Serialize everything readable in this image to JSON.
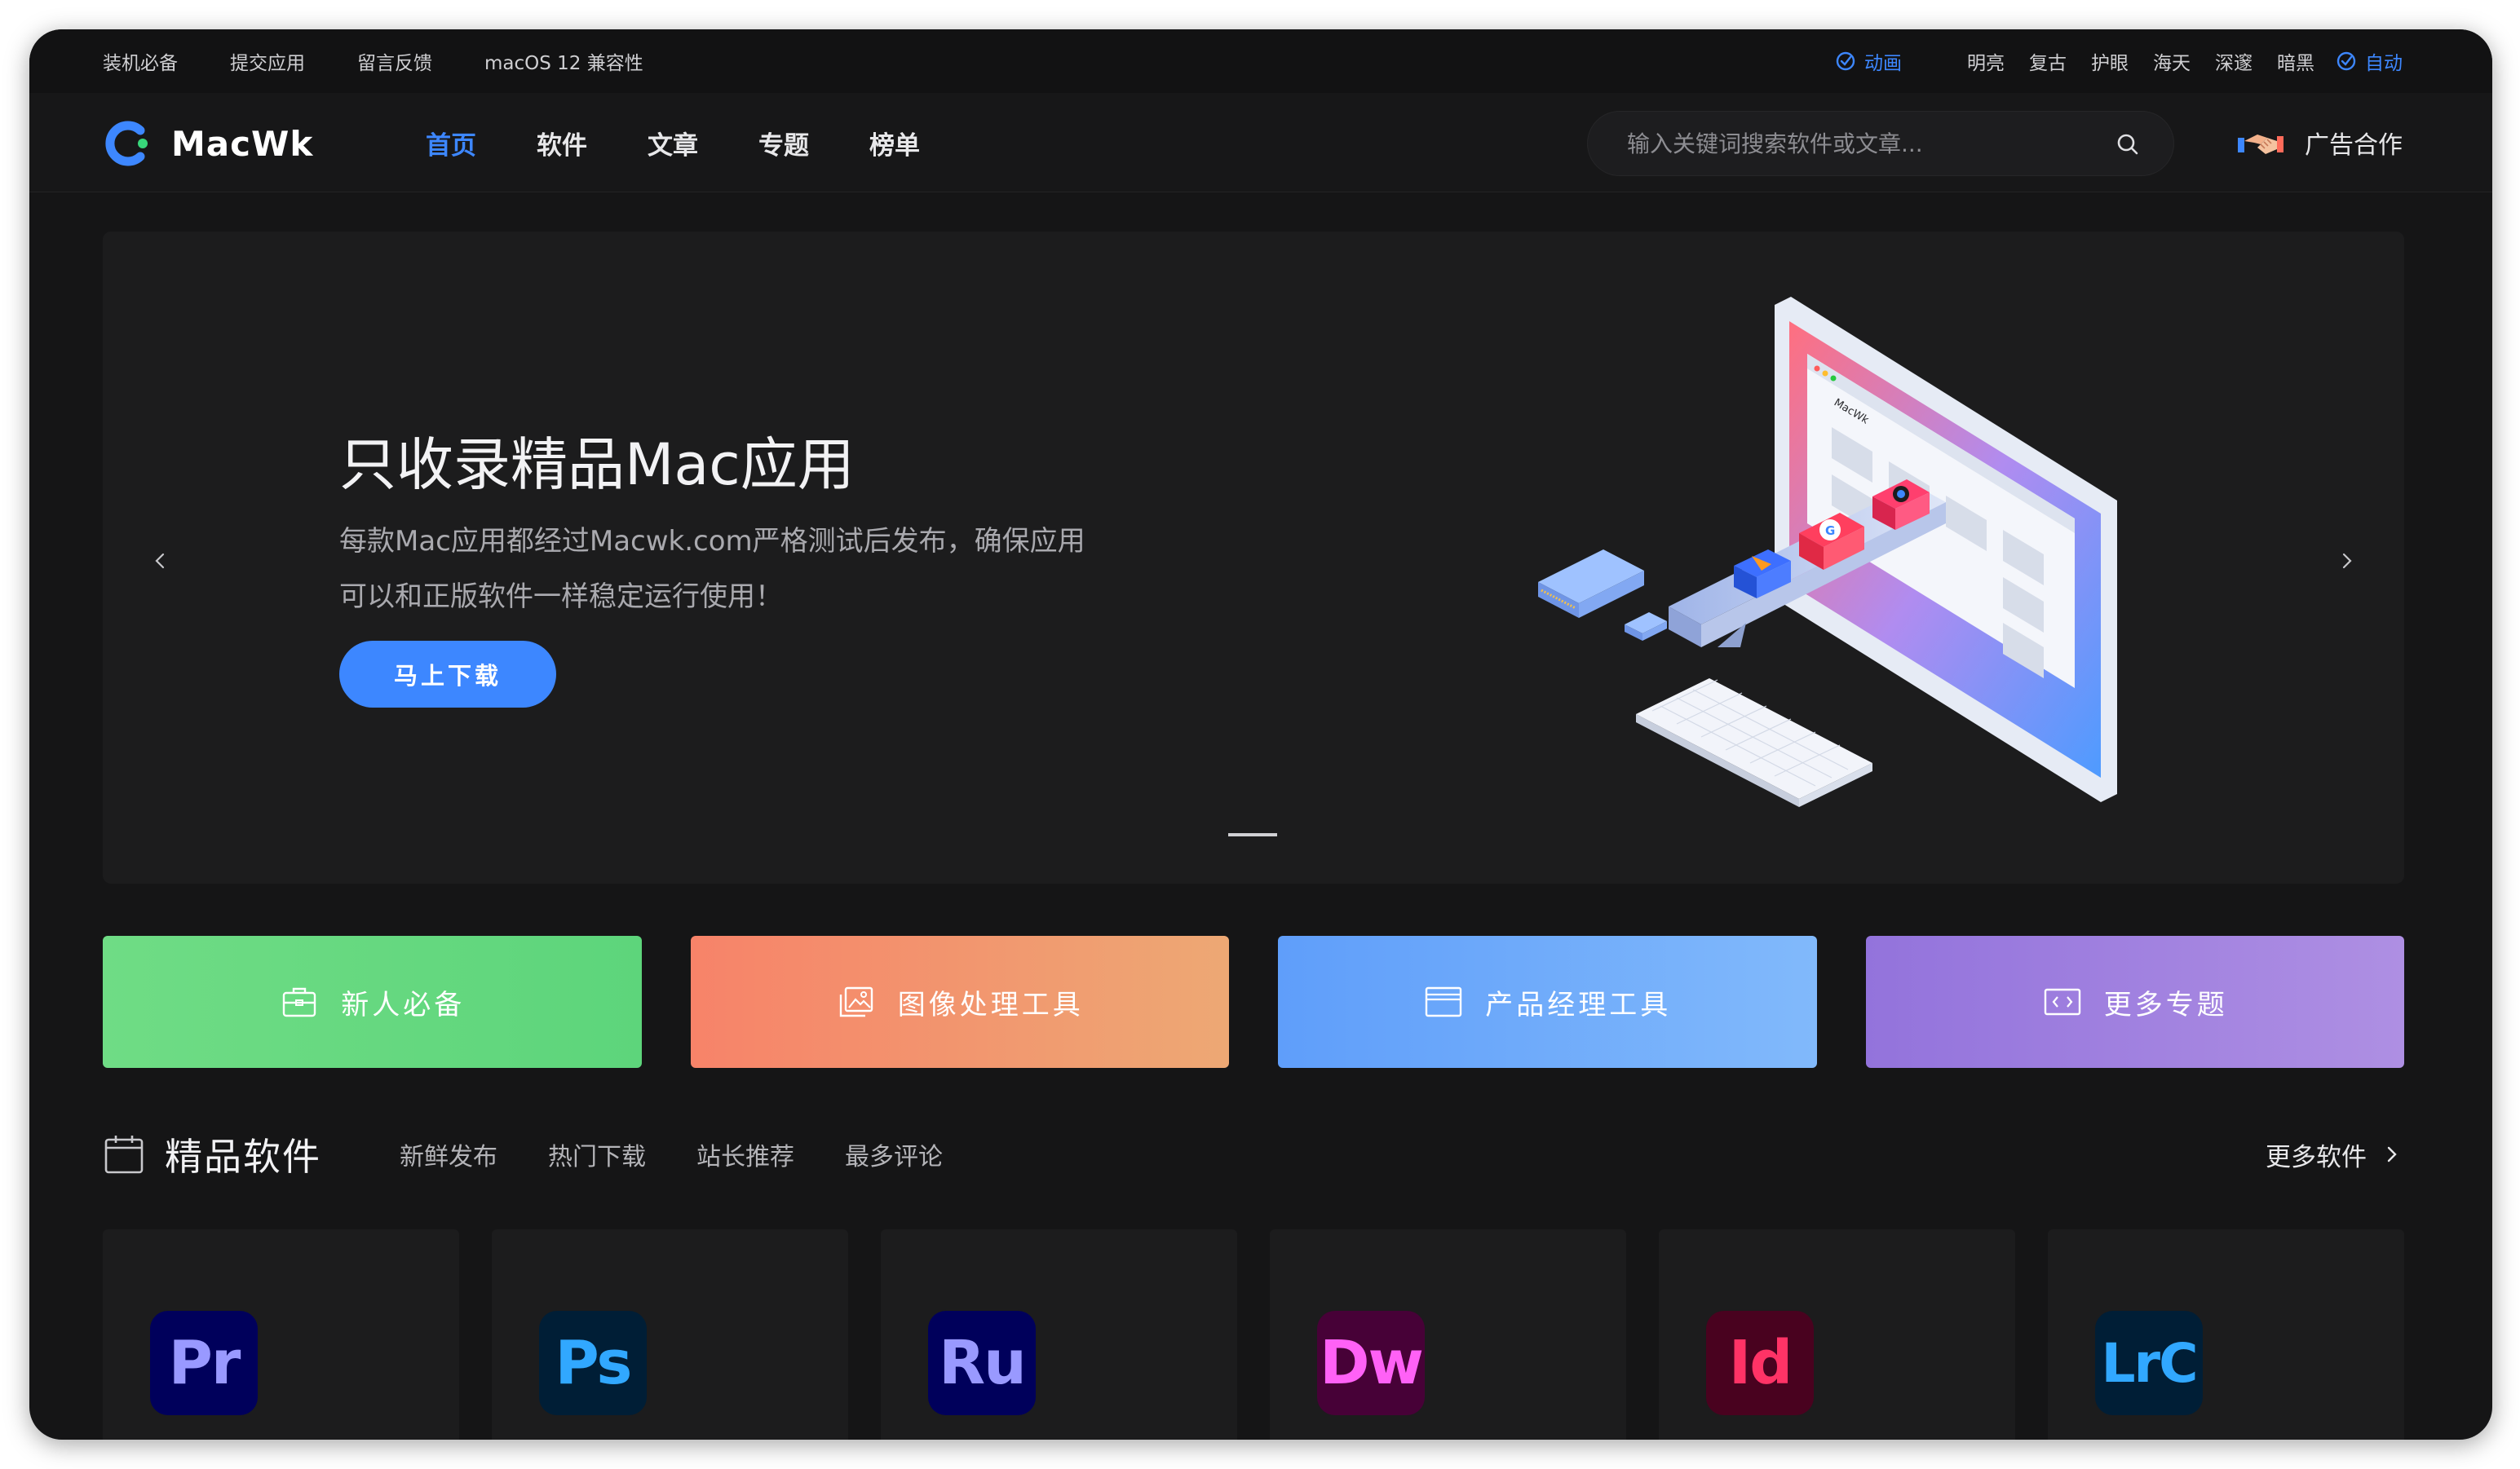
{
  "topbar": {
    "links": [
      "装机必备",
      "提交应用",
      "留言反馈",
      "macOS 12 兼容性"
    ],
    "animation_label": "动画",
    "themes": [
      "明亮",
      "复古",
      "护眼",
      "海天",
      "深邃",
      "暗黑"
    ],
    "auto_label": "自动"
  },
  "nav": {
    "logo_text": "MacWk",
    "menu": [
      "首页",
      "软件",
      "文章",
      "专题",
      "榜单"
    ],
    "active_menu": "首页",
    "search_placeholder": "输入关键词搜索软件或文章...",
    "ad_label": "广告合作"
  },
  "hero": {
    "title": "只收录精品Mac应用",
    "subtitle": "每款Mac应用都经过Macwk.com严格测试后发布，确保应用可以和正版软件一样稳定运行使用！",
    "button_label": "马上下载",
    "screen_brand": "MacWk"
  },
  "tiles": [
    "新人必备",
    "图像处理工具",
    "产品经理工具",
    "更多专题"
  ],
  "section": {
    "title": "精品软件",
    "tabs": [
      "新鲜发布",
      "热门下载",
      "站长推荐",
      "最多评论"
    ],
    "more_label": "更多软件"
  },
  "apps": [
    {
      "abbr": "Pr",
      "icon": "premiere-icon",
      "bg": "#00005b",
      "fg": "#9999ff"
    },
    {
      "abbr": "Ps",
      "icon": "photoshop-icon",
      "bg": "#001e36",
      "fg": "#31a8ff"
    },
    {
      "abbr": "Ru",
      "icon": "rush-icon",
      "bg": "#00005b",
      "fg": "#9999ff"
    },
    {
      "abbr": "Dw",
      "icon": "dreamweaver-icon",
      "bg": "#470137",
      "fg": "#ff61f6"
    },
    {
      "abbr": "Id",
      "icon": "indesign-icon",
      "bg": "#49021f",
      "fg": "#ff3366"
    },
    {
      "abbr": "LrC",
      "icon": "lightroom-classic-icon",
      "bg": "#001e36",
      "fg": "#31a8ff"
    }
  ],
  "colors": {
    "accent": "#3d87ff",
    "background": "#151516",
    "panel": "#1c1c1d"
  }
}
